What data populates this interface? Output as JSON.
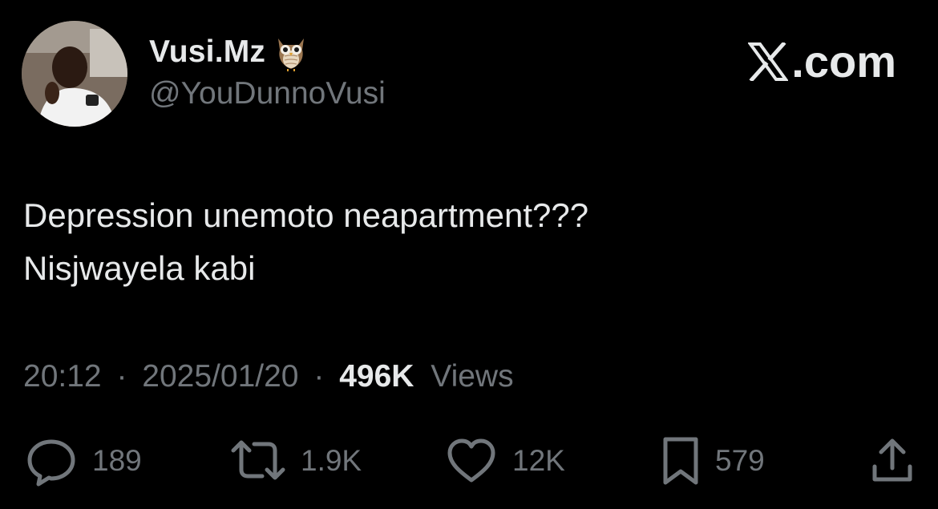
{
  "brand": {
    "label": ".com",
    "icon": "x-logo-icon"
  },
  "author": {
    "display_name": "Vusi.Mz",
    "emoji": "owl-emoji-icon",
    "handle": "@YouDunnoVusi",
    "avatar": "profile-photo"
  },
  "tweet": {
    "lines": [
      "Depression unemoto neapartment???",
      "Nisjwayela kabi"
    ],
    "time": "20:12",
    "separator": "·",
    "date": "2025/01/20",
    "views_count": "496K",
    "views_label": "Views"
  },
  "actions": {
    "reply": {
      "icon": "reply-icon",
      "count": "189"
    },
    "repost": {
      "icon": "repost-icon",
      "count": "1.9K"
    },
    "like": {
      "icon": "heart-icon",
      "count": "12K"
    },
    "bookmark": {
      "icon": "bookmark-icon",
      "count": "579"
    },
    "share": {
      "icon": "share-icon"
    }
  },
  "colors": {
    "background": "#000000",
    "primary_text": "#e7e9ea",
    "secondary_text": "#71767b"
  }
}
